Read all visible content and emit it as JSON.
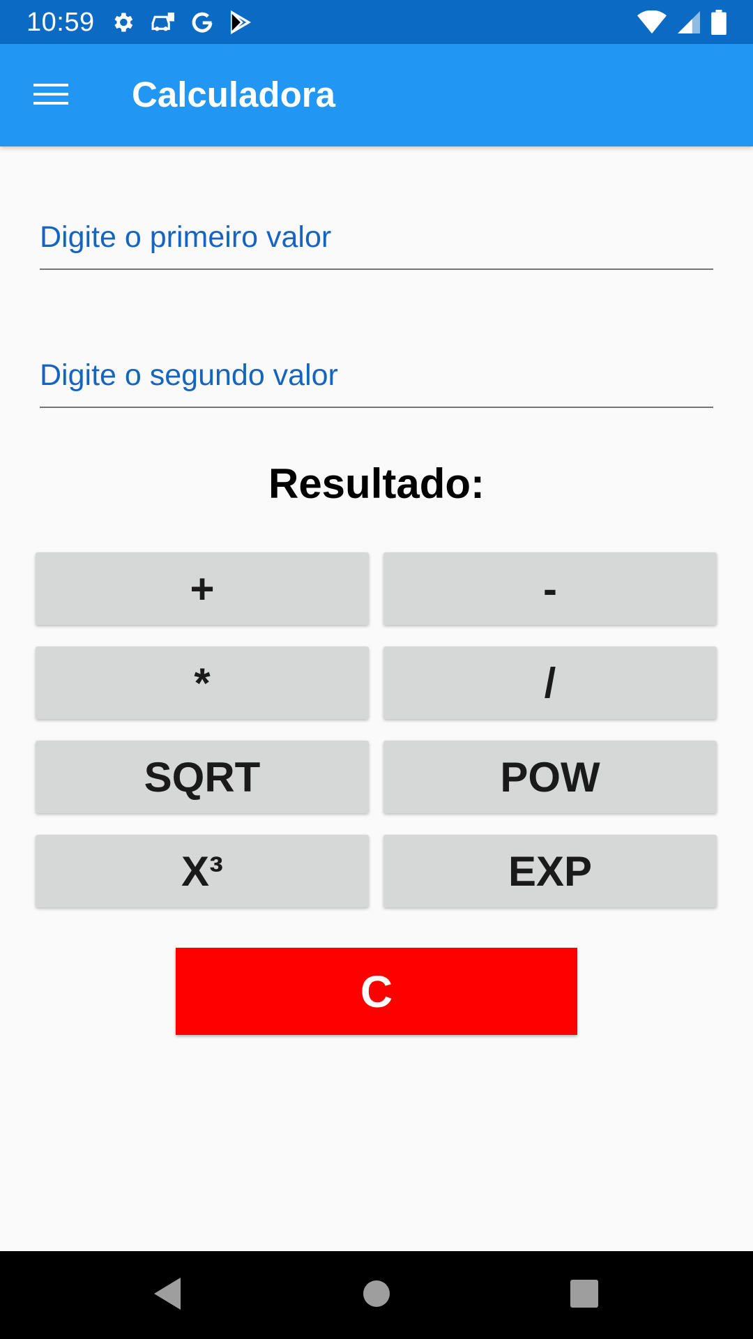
{
  "status_bar": {
    "time": "10:59",
    "icons_left": [
      "settings-icon",
      "car-icon",
      "google-icon",
      "play-store-icon"
    ],
    "icons_right": [
      "wifi-icon",
      "signal-icon",
      "battery-icon"
    ]
  },
  "app_bar": {
    "title": "Calculadora",
    "menu_icon": "menu-icon",
    "color": "#2196f3"
  },
  "form": {
    "first_value": {
      "placeholder": "Digite o primeiro valor",
      "value": ""
    },
    "second_value": {
      "placeholder": "Digite o segundo valor",
      "value": ""
    }
  },
  "result": {
    "label": "Resultado:"
  },
  "operations": {
    "add": "+",
    "subtract": "-",
    "multiply": "*",
    "divide": "/",
    "sqrt": "SQRT",
    "pow": "POW",
    "cube": "X³",
    "exp": "EXP"
  },
  "clear": {
    "label": "C",
    "color": "#ff0000"
  },
  "navigation": {
    "icons": [
      "back-icon",
      "home-icon",
      "recents-icon"
    ]
  }
}
